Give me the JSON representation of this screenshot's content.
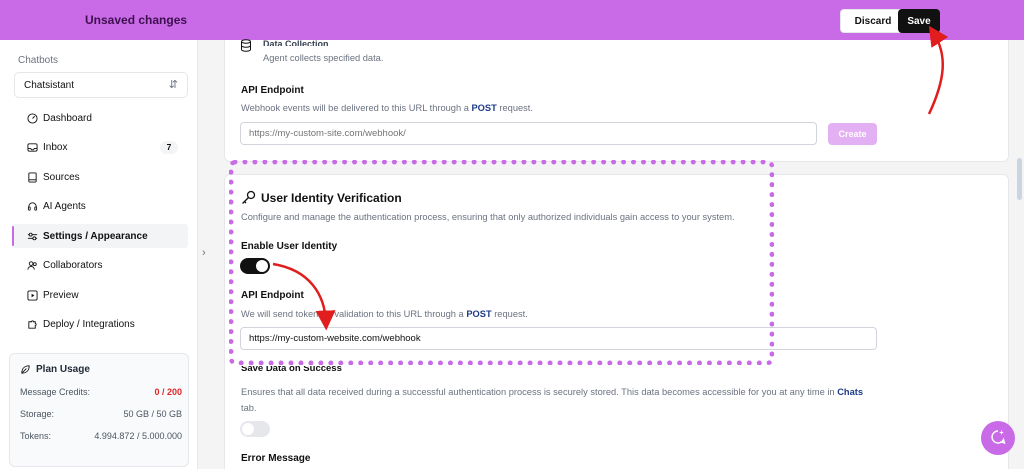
{
  "topbar": {
    "title": "Unsaved changes",
    "discard_label": "Discard",
    "save_label": "Save"
  },
  "sidebar": {
    "section_label": "Chatbots",
    "selected_chatbot": "Chatsistant",
    "items": [
      {
        "label": "Dashboard",
        "icon": "gauge-icon"
      },
      {
        "label": "Inbox",
        "icon": "inbox-icon",
        "badge": "7"
      },
      {
        "label": "Sources",
        "icon": "book-icon"
      },
      {
        "label": "AI Agents",
        "icon": "headset-icon"
      },
      {
        "label": "Settings / Appearance",
        "icon": "sliders-icon",
        "active": true
      },
      {
        "label": "Collaborators",
        "icon": "users-icon"
      },
      {
        "label": "Preview",
        "icon": "play-icon"
      },
      {
        "label": "Deploy / Integrations",
        "icon": "puzzle-icon"
      }
    ],
    "plan": {
      "title": "Plan Usage",
      "rows": [
        {
          "label": "Message Credits:",
          "value": "0 / 200"
        },
        {
          "label": "Storage:",
          "value": "50 GB / 50 GB"
        },
        {
          "label": "Tokens:",
          "value": "4.994.872 / 5.000.000"
        }
      ]
    }
  },
  "data_collection": {
    "title": "Data Collection",
    "desc": "Agent collects specified data."
  },
  "webhook": {
    "title": "API Endpoint",
    "desc_pre": "Webhook events will be delivered to this URL through a ",
    "desc_bold": "POST",
    "desc_post": " request.",
    "placeholder": "https://my-custom-site.com/webhook/",
    "create_label": "Create"
  },
  "identity": {
    "title": "User Identity Verification",
    "desc": "Configure and manage the authentication process, ensuring that only authorized individuals gain access to your system.",
    "enable_label": "Enable User Identity",
    "enable_on": true,
    "endpoint_title": "API Endpoint",
    "endpoint_desc_pre": "We will send token for validation to this URL through a ",
    "endpoint_desc_bold": "POST",
    "endpoint_desc_post": " request.",
    "endpoint_value": "https://my-custom-website.com/webhook"
  },
  "save_data": {
    "title": "Save Data on Success",
    "desc_pre": "Ensures that all data received during a successful authentication process is securely stored. This data becomes accessible for you at any time in ",
    "desc_bold": "Chats",
    "desc_post": "tab.",
    "enabled": false
  },
  "error_message": {
    "title": "Error Message"
  },
  "colors": {
    "accent": "#c96be6",
    "annotation_arrow": "#e11d1d"
  }
}
